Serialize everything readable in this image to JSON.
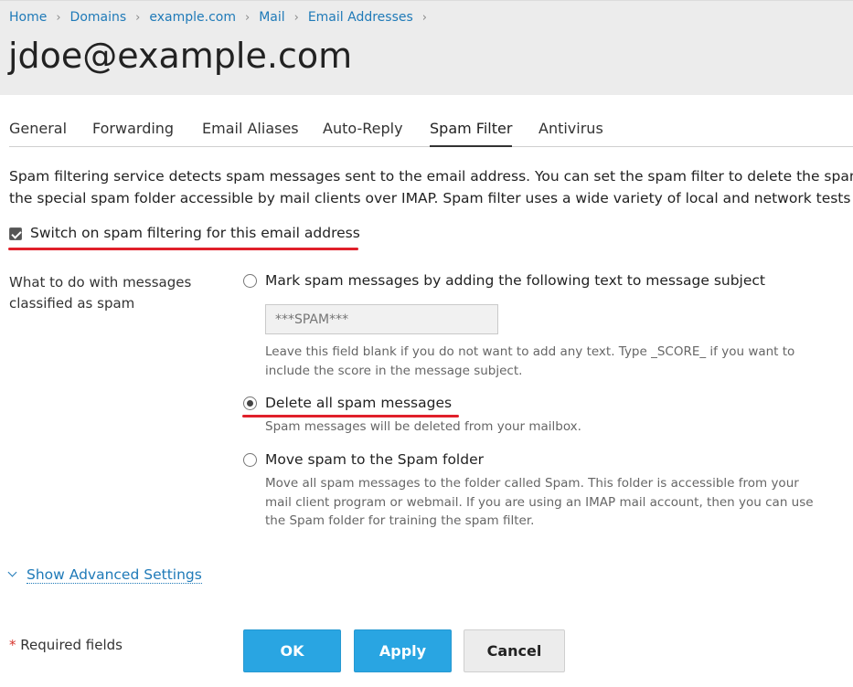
{
  "breadcrumb": [
    "Home",
    "Domains",
    "example.com",
    "Mail",
    "Email Addresses"
  ],
  "page": {
    "title": "jdoe@example.com"
  },
  "tabs": [
    "General",
    "Forwarding",
    "Email Aliases",
    "Auto-Reply",
    "Spam Filter",
    "Antivirus"
  ],
  "active_tab": "Spam Filter",
  "intro": {
    "line1": "Spam filtering service detects spam messages sent to the email address. You can set the spam filter to delete the spam",
    "line2": "the special spam folder accessible by mail clients over IMAP. Spam filter uses a wide variety of local and network tests to"
  },
  "spam_filter": {
    "enabled": true,
    "switch_label": "Switch on spam filtering for this email address",
    "action_label_line1": "What to do with messages",
    "action_label_line2": "classified as spam",
    "selected_option": "delete",
    "options": {
      "mark": {
        "label": "Mark spam messages by adding the following text to message subject",
        "text_placeholder": "***SPAM***",
        "hint_line1": "Leave this field blank if you do not want to add any text. Type _SCORE_ if you want to",
        "hint_line2": "include the score in the message subject."
      },
      "delete": {
        "label": "Delete all spam messages",
        "hint": "Spam messages will be deleted from your mailbox."
      },
      "move": {
        "label": "Move spam to the Spam folder",
        "hint_line1": "Move all spam messages to the folder called Spam. This folder is accessible from your",
        "hint_line2": "mail client program or webmail. If you are using an IMAP mail account, then you can use",
        "hint_line3": "the Spam folder for training the spam filter."
      }
    }
  },
  "advanced": {
    "label": "Show Advanced Settings"
  },
  "footer": {
    "required_star": "*",
    "required_text": "Required fields",
    "ok": "OK",
    "apply": "Apply",
    "cancel": "Cancel"
  },
  "colors": {
    "link": "#1f7ab8",
    "primary_button": "#29a5e2",
    "highlight_underline": "#e0202a"
  },
  "icons": {
    "breadcrumb_separator": "chevron-right-icon",
    "checkbox": "checkmark-icon",
    "advanced_toggle": "chevron-down-icon"
  }
}
